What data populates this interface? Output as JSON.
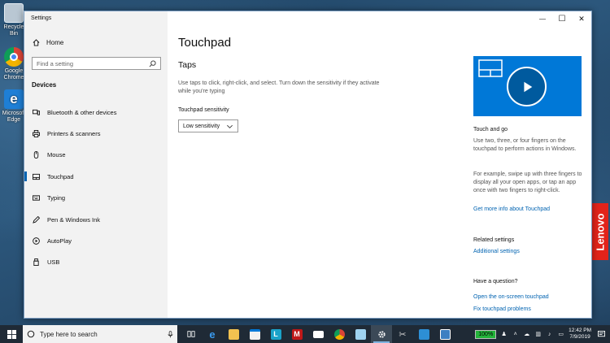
{
  "desktop": {
    "icons": [
      {
        "label": "Recycle Bin"
      },
      {
        "label": "Google Chrome"
      },
      {
        "label": "Microsoft Edge"
      }
    ],
    "brand": "Lenovo"
  },
  "window": {
    "title": "Settings",
    "controls": {
      "minimize": "—",
      "maximize": "☐",
      "close": "✕"
    }
  },
  "sidebar": {
    "home_label": "Home",
    "search_placeholder": "Find a setting",
    "section": "Devices",
    "items": [
      {
        "label": "Bluetooth & other devices",
        "icon": "bluetooth-icon"
      },
      {
        "label": "Printers & scanners",
        "icon": "printer-icon"
      },
      {
        "label": "Mouse",
        "icon": "mouse-icon"
      },
      {
        "label": "Touchpad",
        "icon": "touchpad-icon",
        "active": true
      },
      {
        "label": "Typing",
        "icon": "keyboard-icon"
      },
      {
        "label": "Pen & Windows Ink",
        "icon": "pen-icon"
      },
      {
        "label": "AutoPlay",
        "icon": "autoplay-icon"
      },
      {
        "label": "USB",
        "icon": "usb-icon"
      }
    ]
  },
  "main": {
    "title": "Touchpad",
    "subtitle": "Taps",
    "description": "Use taps to click, right-click, and select. Turn down the sensitivity if they activate while you're typing",
    "sensitivity_label": "Touchpad sensitivity",
    "sensitivity_value": "Low sensitivity"
  },
  "right_panel": {
    "video_heading": "Touch and go",
    "video_text1": "Use two, three, or four fingers on the touchpad to perform actions in Windows.",
    "video_text2": "For example, swipe up with three fingers to display all your open apps, or tap an app once with two fingers to right-click.",
    "more_info_link": "Get more info about Touchpad",
    "related_heading": "Related settings",
    "related_link": "Additional settings",
    "question_heading": "Have a question?",
    "question_link1": "Open the on-screen touchpad",
    "question_link2": "Fix touchpad problems"
  },
  "taskbar": {
    "search_placeholder": "Type here to search",
    "battery": "100%",
    "time": "12:42 PM",
    "date": "7/9/2019"
  }
}
